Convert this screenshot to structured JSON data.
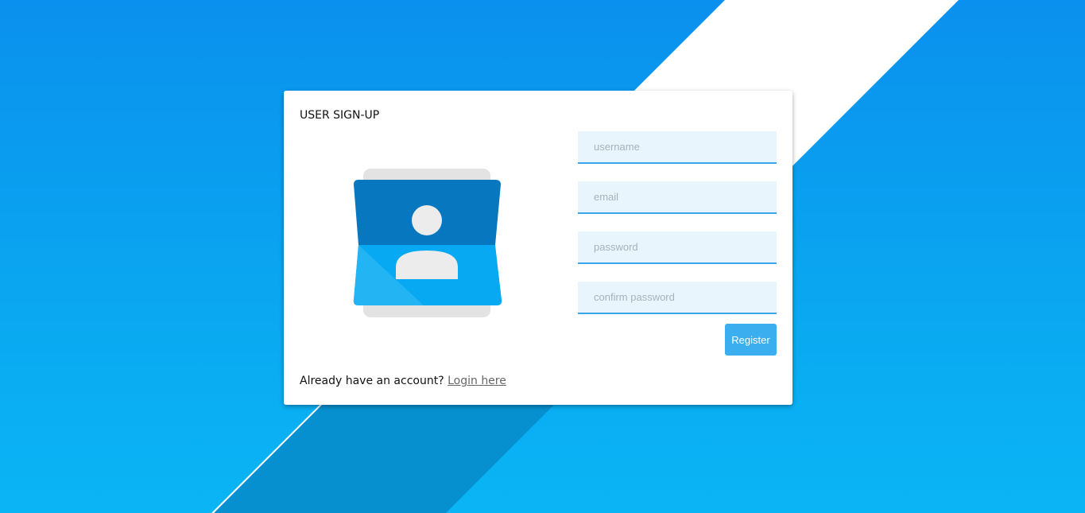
{
  "card": {
    "title": "USER SIGN-UP"
  },
  "form": {
    "username_placeholder": "username",
    "email_placeholder": "email",
    "password_placeholder": "password",
    "confirm_password_placeholder": "confirm password",
    "register_label": "Register"
  },
  "footer": {
    "prompt": "Already have an account?",
    "login_link": "Login here"
  },
  "illustration": {
    "icon": "account-box-icon"
  },
  "colors": {
    "background_top": "#0a90ee",
    "background_bottom": "#0ab5f5",
    "accent": "#3aa6ee",
    "field_background": "#e9f5fc",
    "button": "#3aaeef"
  }
}
